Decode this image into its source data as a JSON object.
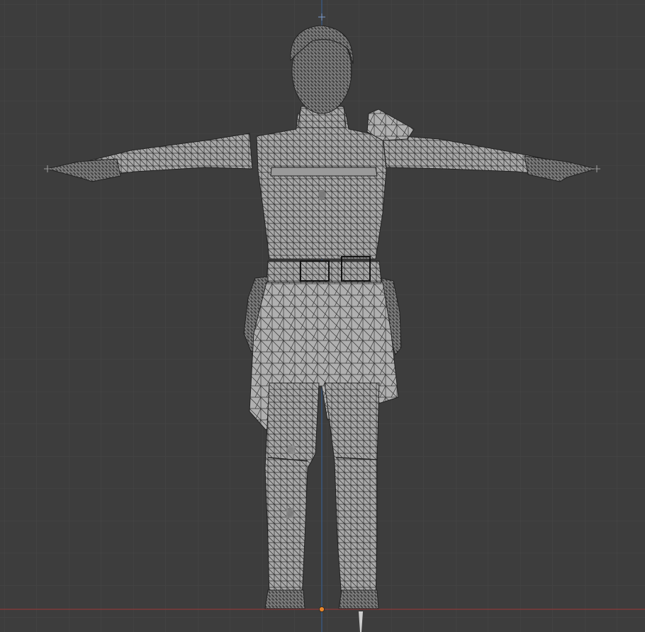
{
  "viewport": {
    "background": "#3d3d3d",
    "grid_minor_color": "#444444",
    "grid_major_color": "#4d4d4d",
    "x_axis_color": "#8a3a3a",
    "z_axis_color": "#3a5c8a",
    "origin_color": "#e8862a",
    "mesh_fill_color": "#a6a6a6",
    "mesh_wire_color": "#2a2a2a",
    "object": "character-mesh-t-pose",
    "shading": "wireframe-over-solid",
    "view": "front-orthographic"
  }
}
